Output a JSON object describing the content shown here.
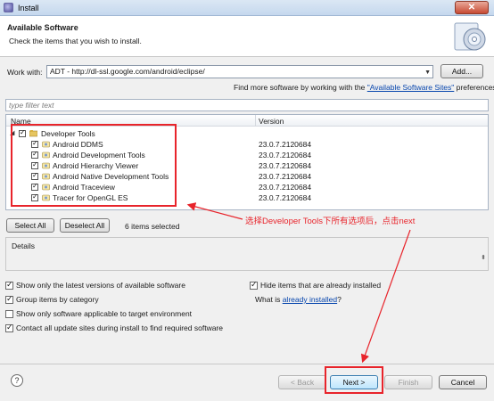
{
  "window": {
    "title": "Install"
  },
  "header": {
    "title": "Available Software",
    "subtitle": "Check the items that you wish to install."
  },
  "work_with": {
    "label": "Work with:",
    "value": "ADT - http://dl-ssl.google.com/android/eclipse/",
    "add_label": "Add..."
  },
  "find_more": {
    "prefix": "Find more software by working with the ",
    "link": "\"Available Software Sites\"",
    "suffix": " preferences."
  },
  "filter": {
    "placeholder": "type filter text"
  },
  "table": {
    "headers": {
      "name": "Name",
      "version": "Version"
    },
    "category": {
      "name": "Developer Tools"
    },
    "items": [
      {
        "name": "Android DDMS",
        "version": "23.0.7.2120684"
      },
      {
        "name": "Android Development Tools",
        "version": "23.0.7.2120684"
      },
      {
        "name": "Android Hierarchy Viewer",
        "version": "23.0.7.2120684"
      },
      {
        "name": "Android Native Development Tools",
        "version": "23.0.7.2120684"
      },
      {
        "name": "Android Traceview",
        "version": "23.0.7.2120684"
      },
      {
        "name": "Tracer for OpenGL ES",
        "version": "23.0.7.2120684"
      }
    ]
  },
  "selection": {
    "select_all": "Select All",
    "deselect_all": "Deselect All",
    "count_text": "6 items selected"
  },
  "annotation": {
    "text": "选择Developer Tools下所有选项后，点击next"
  },
  "details": {
    "label": "Details"
  },
  "options": {
    "latest_versions": {
      "label": "Show only the latest versions of available software",
      "checked": true
    },
    "group_by_category": {
      "label": "Group items by category",
      "checked": true
    },
    "target_env": {
      "label": "Show only software applicable to target environment",
      "checked": false
    },
    "contact_sites": {
      "label": "Contact all update sites during install to find required software",
      "checked": true
    },
    "hide_installed": {
      "label": "Hide items that are already installed",
      "checked": true
    },
    "what_is": {
      "prefix": "What is ",
      "link": "already installed",
      "suffix": "?"
    }
  },
  "buttons": {
    "back": "< Back",
    "next": "Next >",
    "finish": "Finish",
    "cancel": "Cancel"
  },
  "colors": {
    "annotation_red": "#e8242b",
    "link_blue": "#0645ad"
  }
}
